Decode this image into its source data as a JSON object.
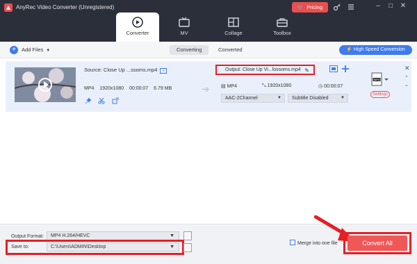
{
  "window": {
    "title": "AnyRec Video Converter (Unregistered)",
    "pricing_label": "Pricing",
    "controls": [
      "key-icon",
      "menu-icon",
      "minimize-icon",
      "maximize-icon",
      "close-icon"
    ]
  },
  "nav": {
    "tabs": [
      {
        "label": "Converter",
        "icon": "converter-icon",
        "active": true
      },
      {
        "label": "MV",
        "icon": "tv-icon",
        "active": false
      },
      {
        "label": "Collage",
        "icon": "collage-icon",
        "active": false
      },
      {
        "label": "Toolbox",
        "icon": "toolbox-icon",
        "active": false
      }
    ]
  },
  "toolbar": {
    "add_files": "Add Files",
    "tabs": [
      "Converting",
      "Converted"
    ],
    "active_tab": "Converting",
    "high_speed": "High Speed Conversion"
  },
  "file": {
    "source_name": "Source: Close Up ...ssoms.mp4",
    "format": "MP4",
    "resolution": "1920x1080",
    "duration": "00:00:07",
    "size": "6.79 MB",
    "output_name": "Output: Close Up Vi...lossoms.mp4",
    "out_format": "MP4",
    "out_resolution": "1920x1080",
    "out_duration": "00:00:07",
    "audio_track": "AAC-2Channel",
    "subtitle": "Subtitle Disabled",
    "format_badge": "MP4",
    "settings_label": "Settings"
  },
  "bottom": {
    "output_format_label": "Output Format:",
    "output_format_value": "MP4 H.264/HEVC",
    "save_to_label": "Save to:",
    "save_to_value": "C:\\Users\\ADMIN\\Desktop",
    "merge_label": "Merge into one file",
    "convert_all": "Convert All"
  },
  "colors": {
    "titlebar": "#2b2f3a",
    "accent": "#3e7bec",
    "convert": "#f05757",
    "highlight": "#e41f26"
  }
}
